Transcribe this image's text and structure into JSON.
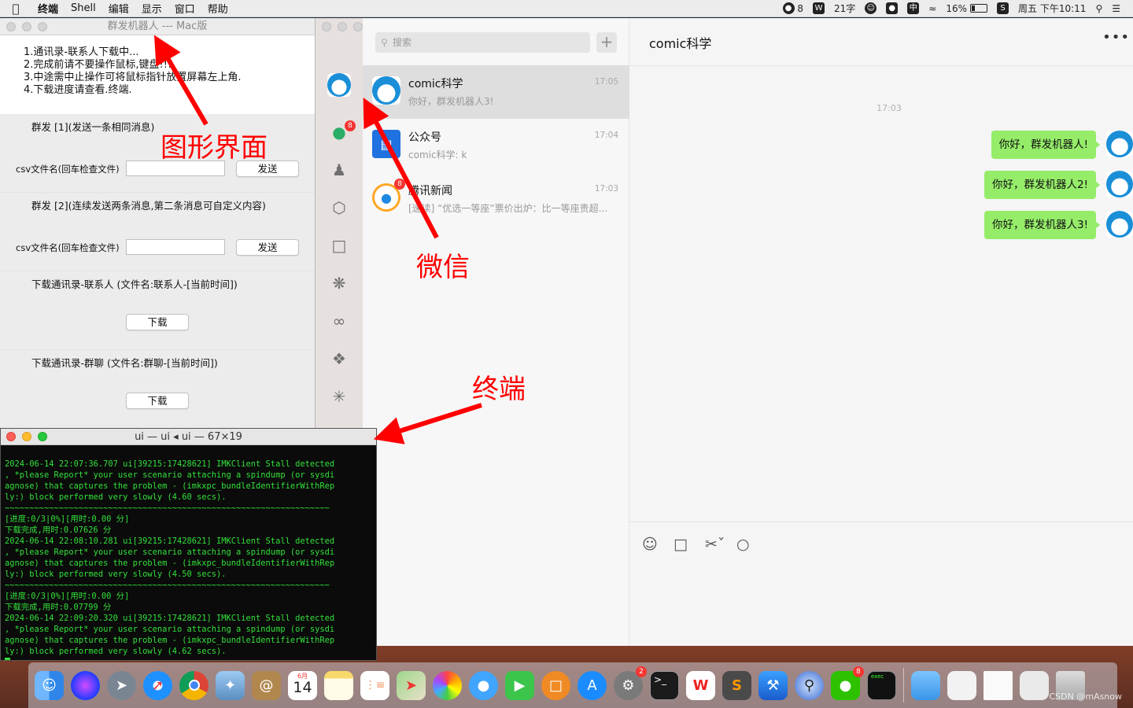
{
  "menubar": {
    "items": [
      "终端",
      "Shell",
      "编辑",
      "显示",
      "窗口",
      "帮助"
    ],
    "status": {
      "wechat_count": "8",
      "word_count": "21字",
      "input_method": "中",
      "battery": "16%",
      "datetime": "周五 下午10:11"
    }
  },
  "bot": {
    "title": "群发机器人  ---  Mac版",
    "instructions": [
      "1.通讯录-联系人下载中...",
      "2.完成前请不要操作鼠标,键盘!!!",
      "3.中途需中止操作可将鼠标指针放置屏幕左上角.",
      "4.下载进度请查看.终端."
    ],
    "section1": {
      "title": "群发 [1](发送一条相同消息)",
      "csv_label": "csv文件名(回车检查文件)",
      "csv_value": "",
      "send": "发送"
    },
    "section2": {
      "title": "群发 [2](连续发送两条消息,第二条消息可自定义内容)",
      "csv_label": "csv文件名(回车检查文件)",
      "csv_value": "",
      "send": "发送"
    },
    "section3": {
      "title": "下载通讯录-联系人 (文件名:联系人-[当前时间])",
      "button": "下载"
    },
    "section4": {
      "title": "下载通讯录-群聊 (文件名:群聊-[当前时间])",
      "button": "下载"
    }
  },
  "wechat": {
    "rail_badge": "8",
    "search_placeholder": "搜索",
    "conversations": [
      {
        "name": "comic科学",
        "message": "你好，群发机器人3!",
        "time": "17:05"
      },
      {
        "name": "公众号",
        "message": "comic科学: k",
        "time": "17:04"
      },
      {
        "name": "腾讯新闻",
        "message": "[速读] “优选一等座”票价出炉：比一等座贵超...",
        "time": "17:03",
        "badge": "8"
      }
    ],
    "chat": {
      "title": "comic科学",
      "timestamp": "17:03",
      "messages": [
        "你好，群发机器人!",
        "你好，群发机器人2!",
        "你好，群发机器人3!"
      ]
    }
  },
  "terminal": {
    "title": "ui — ui ◂ ui — 67×19",
    "lines": [
      "2024-06-14 22:07:36.707 ui[39215:17428621] IMKClient Stall detected",
      ", *please Report* your user scenario attaching a spindump (or sysdi",
      "agnose) that captures the problem - (imkxpc_bundleIdentifierWithRep",
      "ly:) block performed very slowly (4.60 secs).",
      "~~~~~~~~~~~~~~~~~~~~~~~~~~~~~~~~~~~~~~~~~~~~~~~~~~~~~~~~~~~~~~~~~~",
      "[进度:0/3|0%][用时:0.00 分]",
      "下载完成,用时:0.07626 分",
      "2024-06-14 22:08:10.281 ui[39215:17428621] IMKClient Stall detected",
      ", *please Report* your user scenario attaching a spindump (or sysdi",
      "agnose) that captures the problem - (imkxpc_bundleIdentifierWithRep",
      "ly:) block performed very slowly (4.50 secs).",
      "~~~~~~~~~~~~~~~~~~~~~~~~~~~~~~~~~~~~~~~~~~~~~~~~~~~~~~~~~~~~~~~~~~",
      "[进度:0/3|0%][用时:0.00 分]",
      "下载完成,用时:0.07799 分",
      "2024-06-14 22:09:20.320 ui[39215:17428621] IMKClient Stall detected",
      ", *please Report* your user scenario attaching a spindump (or sysdi",
      "agnose) that captures the problem - (imkxpc_bundleIdentifierWithRep",
      "ly:) block performed very slowly (4.62 secs)."
    ]
  },
  "annotations": {
    "gui": "图形界面",
    "wechat": "微信",
    "terminal": "终端"
  },
  "dock": {
    "calendar_month": "6月",
    "calendar_day": "14",
    "system_prefs_badge": "2",
    "wechat_badge": "8",
    "terminal_label": "exec",
    "apps": [
      "finder",
      "siri",
      "launchpad",
      "safari",
      "chrome",
      "preview",
      "contacts",
      "calendar",
      "notes",
      "reminders",
      "maps",
      "photos",
      "messages",
      "facetime",
      "books",
      "app-store",
      "system-preferences",
      "terminal",
      "wps",
      "sublime-text",
      "xcode",
      "network-utility",
      "wechat",
      "console",
      "downloads-folder",
      "screenshot-1",
      "document",
      "screenshot-2",
      "trash"
    ]
  },
  "watermark": "CSDN @mAsnow"
}
